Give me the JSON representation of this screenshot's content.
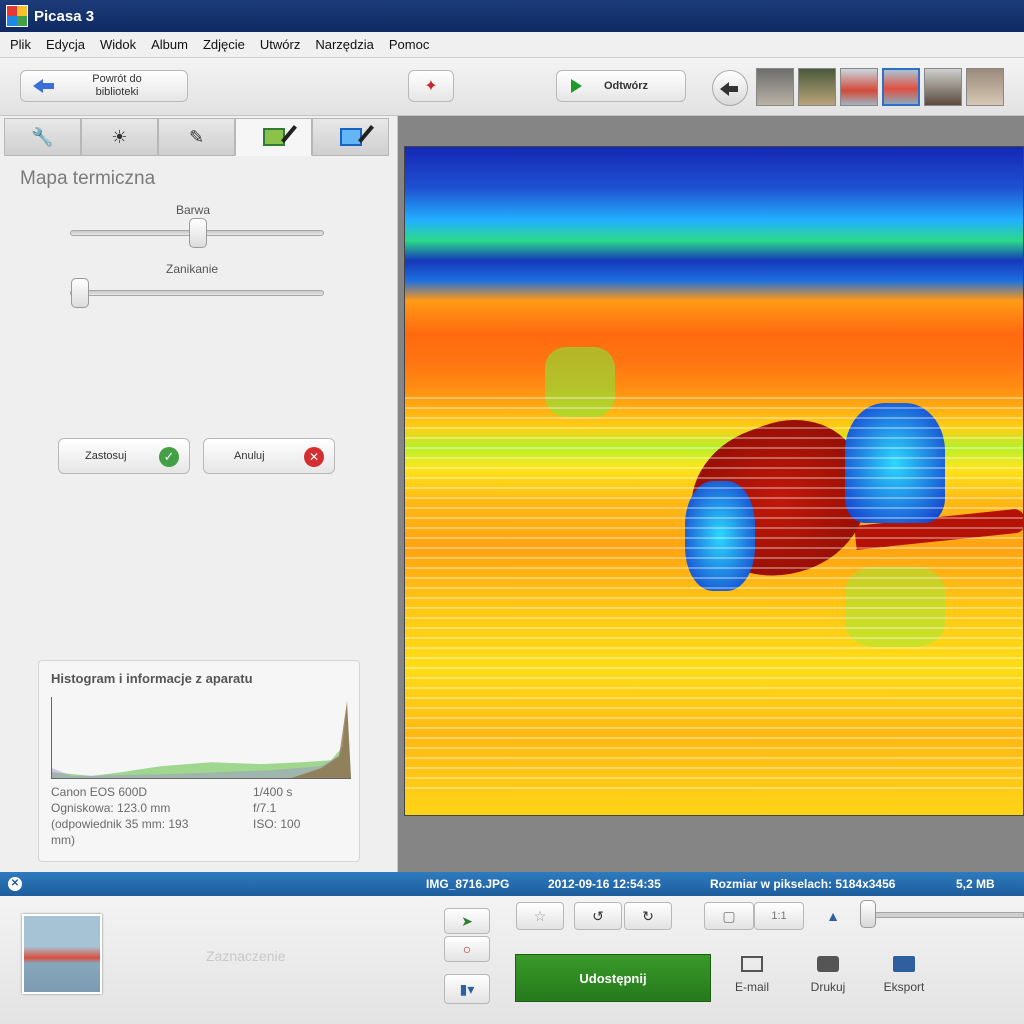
{
  "window": {
    "title": "Picasa 3"
  },
  "menu": [
    "Plik",
    "Edycja",
    "Widok",
    "Album",
    "Zdjęcie",
    "Utwórz",
    "Narzędzia",
    "Pomoc"
  ],
  "toolbar": {
    "back_label_line1": "Powrót do",
    "back_label_line2": "biblioteki",
    "play_label": "Odtwórz"
  },
  "edit_panel": {
    "title": "Mapa termiczna",
    "slider_color": {
      "label": "Barwa",
      "value": 0.5
    },
    "slider_fade": {
      "label": "Zanikanie",
      "value": 0.0
    },
    "apply_label": "Zastosuj",
    "cancel_label": "Anuluj"
  },
  "histogram": {
    "title": "Histogram i informacje z aparatu",
    "camera": "Canon EOS 600D",
    "focal": "Ogniskowa: 123.0 mm",
    "equiv_line1": "(odpowiednik 35 mm: 193",
    "equiv_line2": "mm)",
    "shutter": "1/400 s",
    "aperture": "f/7.1",
    "iso": "ISO: 100"
  },
  "status": {
    "filename": "IMG_8716.JPG",
    "datetime": "2012-09-16 12:54:35",
    "dimensions": "Rozmiar w pikselach: 5184x3456",
    "filesize": "5,2 MB"
  },
  "tray": {
    "selection_label": "Zaznaczenie",
    "share_label": "Udostępnij",
    "email_label": "E-mail",
    "print_label": "Drukuj",
    "export_label": "Eksport"
  },
  "colors": {
    "title_bar": "#0e2a63",
    "status_bar": "#1d5d9c",
    "share_button": "#2f8a22"
  }
}
